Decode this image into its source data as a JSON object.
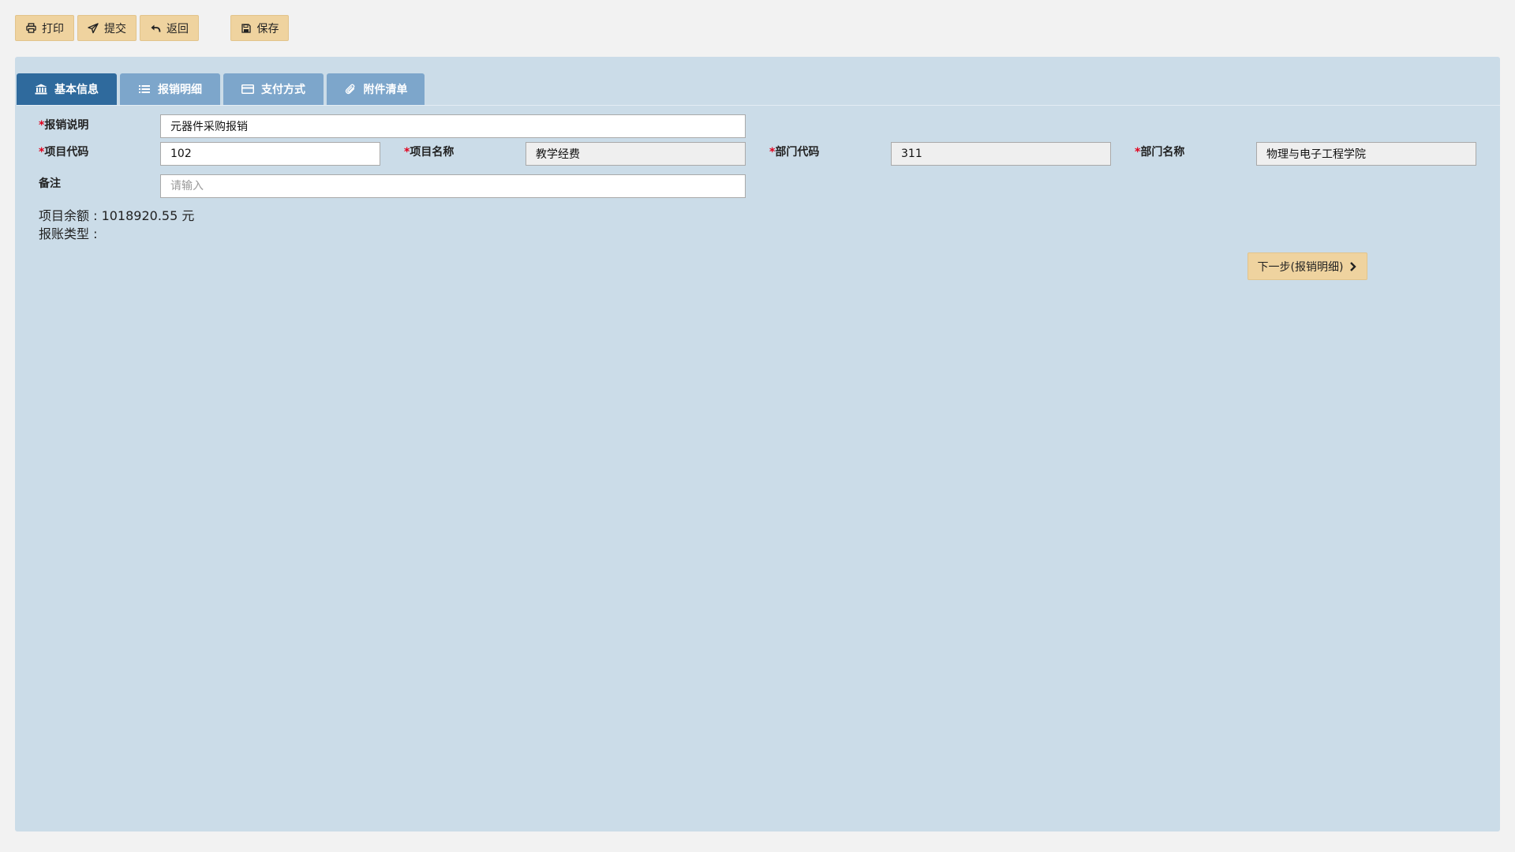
{
  "toolbar": {
    "print_label": "打印",
    "submit_label": "提交",
    "back_label": "返回",
    "save_label": "保存"
  },
  "tabs": [
    {
      "label": "基本信息",
      "icon": "bank-icon",
      "active": true
    },
    {
      "label": "报销明细",
      "icon": "list-icon",
      "active": false
    },
    {
      "label": "支付方式",
      "icon": "credit-card-icon",
      "active": false
    },
    {
      "label": "附件清单",
      "icon": "paperclip-icon",
      "active": false
    }
  ],
  "form": {
    "required_mark": "*",
    "description": {
      "label": "报销说明",
      "value": "元器件采购报销"
    },
    "project_code": {
      "label": "项目代码",
      "value": "102"
    },
    "project_name": {
      "label": "项目名称",
      "value": "教学经费"
    },
    "dept_code": {
      "label": "部门代码",
      "value": "311"
    },
    "dept_name": {
      "label": "部门名称",
      "value": "物理与电子工程学院"
    },
    "remark": {
      "label": "备注",
      "value": "",
      "placeholder": "请输入"
    }
  },
  "info": {
    "balance_text": "项目余额 : 1018920.55 元",
    "account_type_text": "报账类型 :"
  },
  "next_button": {
    "label": "下一步(报销明细)",
    "icon": "chevron-right-icon"
  },
  "colors": {
    "page_background": "#f2f2f2",
    "panel_background": "#cbdce8",
    "button_background": "#efd39f",
    "tab_active": "#2f6a9d",
    "tab_inactive": "#7da6cb",
    "required_mark": "#e0001b"
  }
}
